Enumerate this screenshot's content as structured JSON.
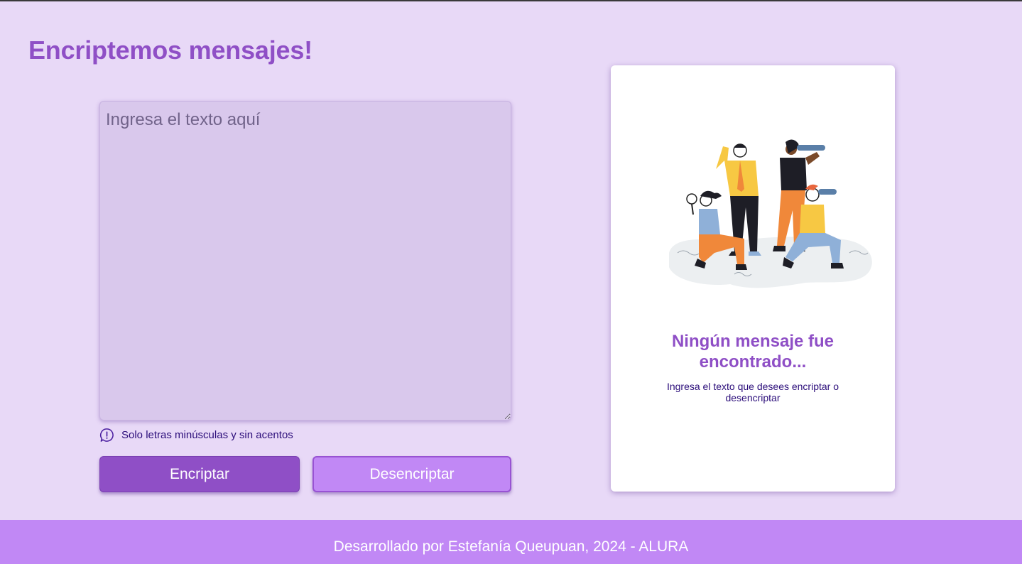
{
  "header": {
    "title": "Encriptemos mensajes!"
  },
  "input": {
    "placeholder": "Ingresa el texto aquí",
    "value": ""
  },
  "hint": {
    "icon": "exclamation-circle-icon",
    "text": "Solo letras minúsculas y sin acentos"
  },
  "buttons": {
    "encrypt_label": "Encriptar",
    "decrypt_label": "Desencriptar"
  },
  "result": {
    "illustration": "people-searching-illustration",
    "title": "Ningún mensaje fue encontrado...",
    "message": "Ingresa el texto que desees encriptar o desencriptar"
  },
  "footer": {
    "text": "Desarrollado por Estefanía Queupuan, 2024 - ALURA"
  },
  "colors": {
    "background": "#e8d9f7",
    "accent": "#8f4fc6",
    "accent_light": "#c188f5",
    "text_dark": "#2b0d7a",
    "card": "#ffffff"
  }
}
